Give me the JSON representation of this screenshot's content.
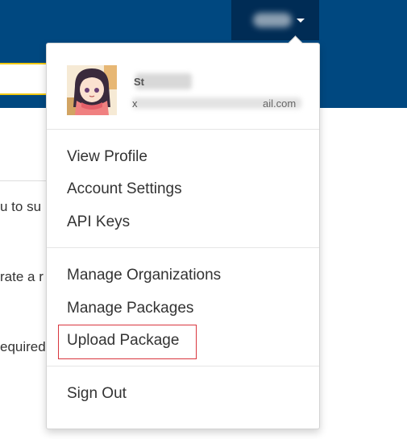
{
  "background": {
    "lines": [
      "u to su",
      "rate a r",
      "equired"
    ]
  },
  "profile": {
    "name_visible": "St",
    "email_prefix_visible": "x",
    "email_suffix_visible": "ail.com"
  },
  "menu": {
    "group1": [
      "View Profile",
      "Account Settings",
      "API Keys"
    ],
    "group2": [
      "Manage Organizations",
      "Manage Packages",
      "Upload Package"
    ],
    "group3": [
      "Sign Out"
    ],
    "highlighted": "Upload Package"
  },
  "colors": {
    "header": "#004880",
    "user_trigger": "#002c55",
    "highlight_border": "#d9363e"
  }
}
